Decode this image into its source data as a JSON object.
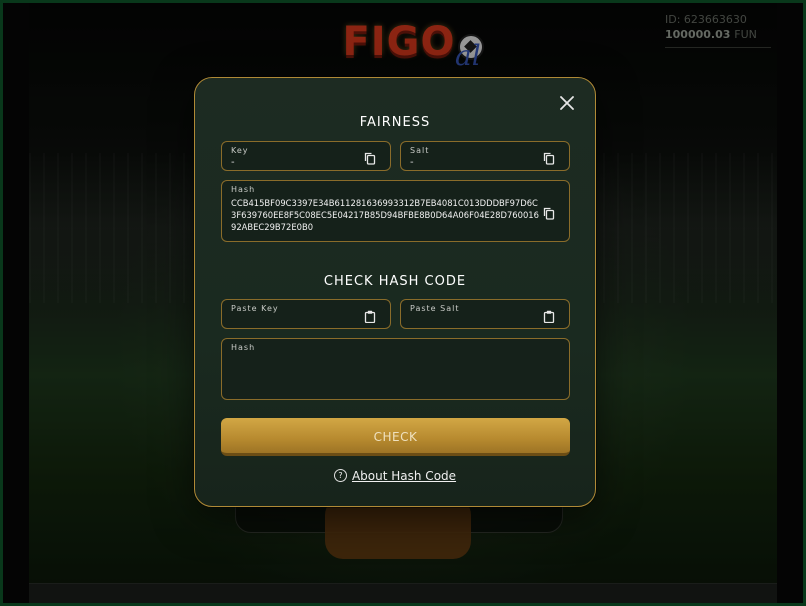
{
  "header": {
    "logo_main": "FIGO",
    "logo_sub": "al",
    "account_id": "ID: 623663630",
    "balance": "100000.03",
    "currency": "FUN"
  },
  "modal": {
    "fairness_title": "FAIRNESS",
    "key_label": "Key",
    "key_value": "-",
    "salt_label": "Salt",
    "salt_value": "-",
    "hash_label": "Hash",
    "hash_value": "CCB415BF09C3397E34B611281636993312B7EB4081C013DDDBF97D6C3F639760EE8F5C08EC5E04217B85D94BFBE8B0D64A06F04E28D76001692ABEC29B72E0B0",
    "check_title": "CHECK HASH CODE",
    "paste_key_label": "Paste Key",
    "paste_salt_label": "Paste Salt",
    "check_hash_label": "Hash",
    "check_button": "CHECK",
    "about_link": "About Hash Code"
  },
  "colors": {
    "accent_gold": "#b08a36",
    "modal_bg": "#1d2b22",
    "button_gold": "#c89a3c"
  },
  "icons": {
    "close": "close-icon",
    "copy": "copy-icon",
    "paste": "clipboard-icon",
    "help": "question-circle-icon"
  }
}
